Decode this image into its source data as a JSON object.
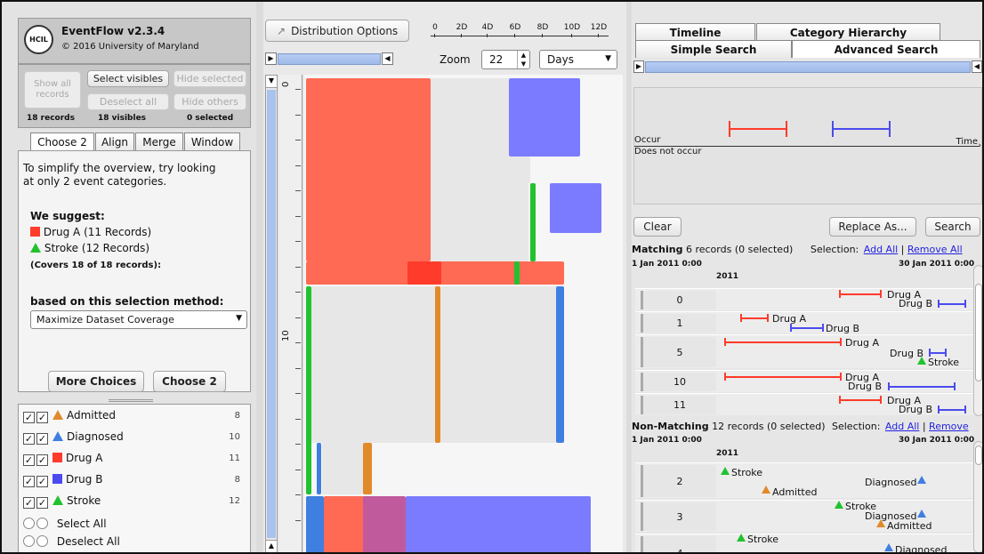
{
  "app": {
    "title": "EventFlow v2.3.4",
    "copyright": "© 2016 University of Maryland",
    "logo": "HCIL"
  },
  "selection_buttons": {
    "show_all": "Show all records",
    "select_visibles": "Select visibles",
    "hide_selected": "Hide selected",
    "deselect_all": "Deselect all",
    "hide_others": "Hide others"
  },
  "counts": {
    "records": "18 records",
    "visibles": "18 visibles",
    "selected": "0 selected"
  },
  "left_tabs": [
    "Choose 2",
    "Align",
    "Merge",
    "Window"
  ],
  "choose2": {
    "intro_1": "To simplify the overview, try looking",
    "intro_2": "at only 2 event categories.",
    "suggest_heading": "We suggest:",
    "suggest_1": "Drug A (11 Records)",
    "suggest_2": "Stroke (12 Records)",
    "covers": "(Covers 18 of 18 records):",
    "method_label": "based on this selection method:",
    "method_value": "Maximize Dataset Coverage",
    "more_choices": "More Choices",
    "choose2_button": "Choose 2"
  },
  "legend": [
    {
      "name": "Admitted",
      "count": "8",
      "color": "#e08a2a",
      "shape": "triangle"
    },
    {
      "name": "Diagnosed",
      "count": "10",
      "color": "#3f7fe0",
      "shape": "triangle"
    },
    {
      "name": "Drug A",
      "count": "11",
      "color": "#ff3b2b",
      "shape": "square"
    },
    {
      "name": "Drug B",
      "count": "8",
      "color": "#4b4bef",
      "shape": "square"
    },
    {
      "name": "Stroke",
      "count": "12",
      "color": "#22c22f",
      "shape": "triangle"
    }
  ],
  "select_all": "Select All",
  "deselect_all_events": "Deselect All",
  "toolbar": {
    "distribution_options": "Distribution Options",
    "zoom_label": "Zoom",
    "zoom_value": "22",
    "unit": "Days",
    "scale_ticks": [
      "0",
      "2D",
      "4D",
      "6D",
      "8D",
      "10D",
      "12D"
    ],
    "axis_ticks": [
      "0",
      "10"
    ]
  },
  "right_tabs": {
    "timeline": "Timeline",
    "category_hierarchy": "Category Hierarchy",
    "simple_search": "Simple Search",
    "advanced_search": "Advanced Search"
  },
  "query": {
    "occur": "Occur",
    "does_not_occur": "Does not occur",
    "time": "Time"
  },
  "query_buttons": {
    "clear": "Clear",
    "replace_as": "Replace As...",
    "search": "Search"
  },
  "matching": {
    "prefix": "Matching",
    "count_text": " 6 records (0 selected)",
    "selection_label": "Selection:",
    "add_all": "Add All",
    "sep": " | ",
    "remove_all": "Remove All",
    "start_date": "1 Jan 2011 0:00",
    "end_date": "30 Jan 2011 0:00",
    "year": "2011",
    "rows": [
      "0",
      "1",
      "5",
      "10",
      "11"
    ]
  },
  "nonmatching": {
    "prefix": "Non-Matching",
    "count_text": " 12 records (0 selected)",
    "selection_label": "Selection:",
    "add_all": "Add All",
    "sep": " | ",
    "remove": "Remove",
    "start_date": "1 Jan 2011 0:00",
    "end_date": "30 Jan 2011 0:00",
    "year": "2011",
    "rows": [
      "2",
      "3",
      "4"
    ]
  },
  "event_labels": {
    "drug_a": "Drug A",
    "drug_b": "Drug B",
    "stroke": "Stroke",
    "admitted": "Admitted",
    "diagnosed": "Diagnosed"
  },
  "colors": {
    "drug_a": "#ff3b2b",
    "drug_b": "#4b4bef",
    "stroke": "#22c22f",
    "admitted": "#e08a2a",
    "diagnosed": "#3f7fe0",
    "link": "#2323e0"
  }
}
